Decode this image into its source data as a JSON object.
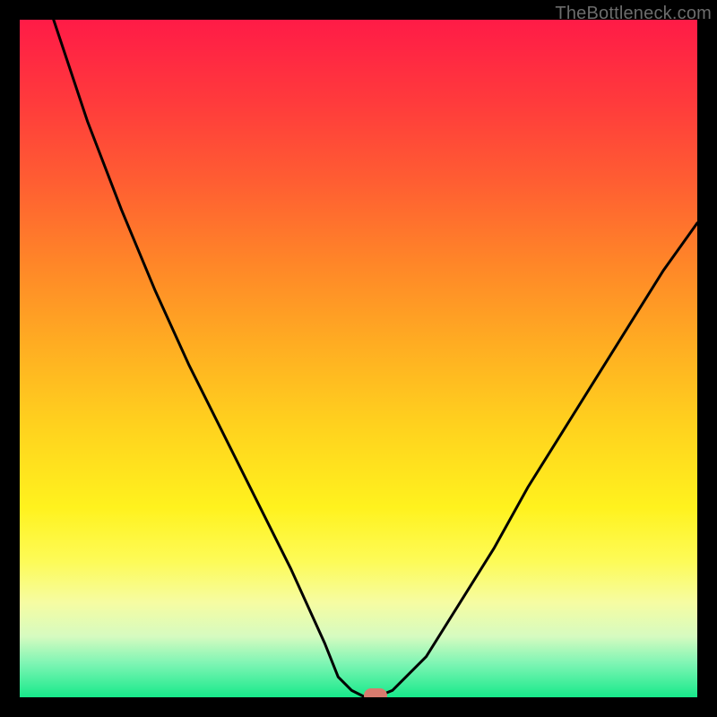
{
  "watermark": "TheBottleneck.com",
  "colors": {
    "background": "#000000",
    "curve_stroke": "#000000",
    "marker_fill": "#d87b6e"
  },
  "chart_data": {
    "type": "line",
    "title": "",
    "xlabel": "",
    "ylabel": "",
    "xlim": [
      0,
      100
    ],
    "ylim": [
      0,
      100
    ],
    "grid": false,
    "legend": false,
    "notes": "Chart has no visible axis ticks or labels. x is horizontal position (0=left edge of plot, 100=right), y is bottleneck percentage (0=bottom/green, 100=top/red). Values estimated from pixels.",
    "series": [
      {
        "name": "bottleneck-curve",
        "x": [
          0,
          5,
          10,
          15,
          20,
          25,
          30,
          35,
          40,
          45,
          47,
          49,
          51,
          52.5,
          55,
          60,
          65,
          70,
          75,
          80,
          85,
          90,
          95,
          100
        ],
        "values": [
          118,
          100,
          85,
          72,
          60,
          49,
          39,
          29,
          19,
          8,
          3,
          1,
          0,
          0,
          1,
          6,
          14,
          22,
          31,
          39,
          47,
          55,
          63,
          70
        ]
      }
    ],
    "marker": {
      "x": 52.5,
      "y": 0
    },
    "gradient_stops": [
      {
        "pct": 0,
        "color": "#ff1b47"
      },
      {
        "pct": 50,
        "color": "#ffc81f"
      },
      {
        "pct": 80,
        "color": "#fdfb58"
      },
      {
        "pct": 100,
        "color": "#17e98a"
      }
    ]
  }
}
